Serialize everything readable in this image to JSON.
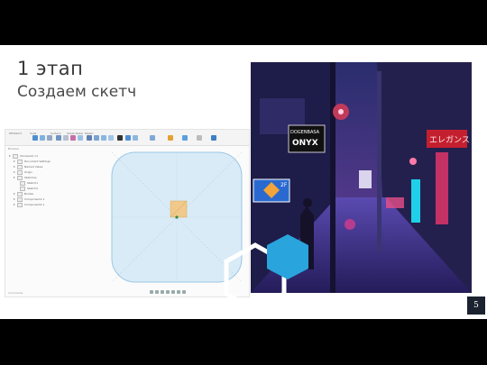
{
  "slide": {
    "title_line1": "1 этап",
    "title_line2": "Создаем скетч",
    "page_number": "5"
  },
  "cad": {
    "toolbar_tabs": [
      "Solid",
      "Surface",
      "Mesh",
      "Sheet Metal",
      "Plastic",
      "Utilities"
    ],
    "toolbar_groups": [
      "Create",
      "Modify",
      "Assemble",
      "Construct",
      "Inspect",
      "Insert",
      "Select"
    ],
    "browser_title": "Browser",
    "tree_items": [
      {
        "label": "(Unsaved) v1"
      },
      {
        "label": "Document Settings"
      },
      {
        "label": "Named Views"
      },
      {
        "label": "Origin"
      },
      {
        "label": "Sketches"
      },
      {
        "label": "Sketch1"
      },
      {
        "label": "Sketch2"
      },
      {
        "label": "Bodies"
      },
      {
        "label": "Component1:1"
      },
      {
        "label": "Component2:1"
      }
    ],
    "footer_label": "Comments",
    "colors": {
      "sketch_fill": "#d9ebf7",
      "sketch_stroke": "#9cc7e4",
      "selection_fill": "#f1c98a"
    }
  },
  "photo": {
    "signs": [
      "DOGENBASA",
      "ONYX",
      "エレガンス",
      "2F"
    ]
  },
  "colors": {
    "hex_blue": "#29a4dc",
    "page_badge": "#1b2330"
  }
}
